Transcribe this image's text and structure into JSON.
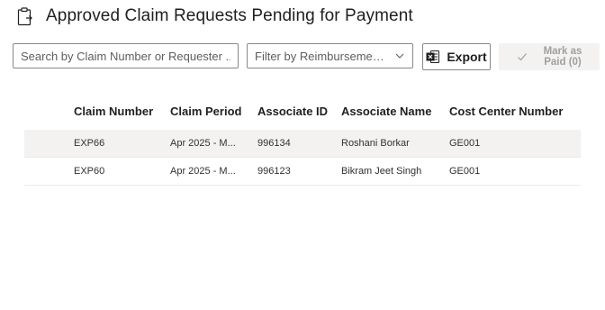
{
  "header": {
    "title": "Approved Claim Requests Pending for Payment"
  },
  "toolbar": {
    "search_placeholder": "Search by Claim Number or Requester ...",
    "filter_placeholder": "Filter by Reimbursement...",
    "export_label": "Export",
    "mark_paid_line1": "Mark as",
    "mark_paid_line2": "Paid (0)"
  },
  "table": {
    "columns": [
      "Claim Number",
      "Claim Period",
      "Associate ID",
      "Associate Name",
      "Cost Center Number"
    ],
    "rows": [
      {
        "claim_number": "EXP66",
        "claim_period": "Apr 2025 - M...",
        "associate_id": "996134",
        "associate_name": "Roshani Borkar",
        "cost_center": "GE001"
      },
      {
        "claim_number": "EXP60",
        "claim_period": "Apr 2025 - M...",
        "associate_id": "996123",
        "associate_name": "Bikram Jeet Singh",
        "cost_center": "GE001"
      }
    ]
  },
  "colors": {
    "text": "#201f1e",
    "border": "#8a8886",
    "disabled_bg": "#f3f2f1",
    "disabled_text": "#a19f9d",
    "row_alt": "#f3f2f1"
  },
  "icons": {
    "page": "clipboard-icon",
    "filter": "chevron-down-icon",
    "export": "excel-icon",
    "mark_paid": "check-icon"
  }
}
